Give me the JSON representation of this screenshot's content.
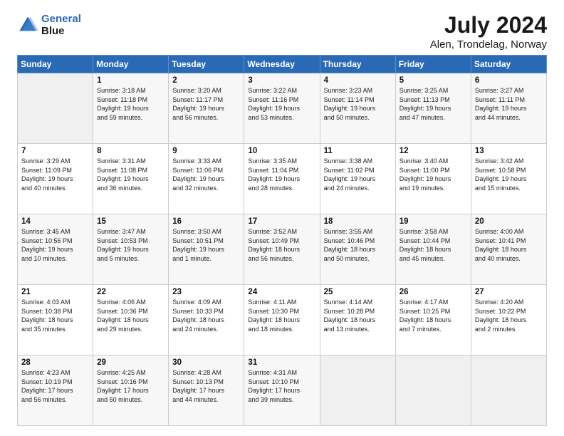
{
  "logo": {
    "line1": "General",
    "line2": "Blue"
  },
  "title": "July 2024",
  "subtitle": "Alen, Trondelag, Norway",
  "header_days": [
    "Sunday",
    "Monday",
    "Tuesday",
    "Wednesday",
    "Thursday",
    "Friday",
    "Saturday"
  ],
  "weeks": [
    [
      {
        "day": "",
        "content": ""
      },
      {
        "day": "1",
        "content": "Sunrise: 3:18 AM\nSunset: 11:18 PM\nDaylight: 19 hours\nand 59 minutes."
      },
      {
        "day": "2",
        "content": "Sunrise: 3:20 AM\nSunset: 11:17 PM\nDaylight: 19 hours\nand 56 minutes."
      },
      {
        "day": "3",
        "content": "Sunrise: 3:22 AM\nSunset: 11:16 PM\nDaylight: 19 hours\nand 53 minutes."
      },
      {
        "day": "4",
        "content": "Sunrise: 3:23 AM\nSunset: 11:14 PM\nDaylight: 19 hours\nand 50 minutes."
      },
      {
        "day": "5",
        "content": "Sunrise: 3:25 AM\nSunset: 11:13 PM\nDaylight: 19 hours\nand 47 minutes."
      },
      {
        "day": "6",
        "content": "Sunrise: 3:27 AM\nSunset: 11:11 PM\nDaylight: 19 hours\nand 44 minutes."
      }
    ],
    [
      {
        "day": "7",
        "content": "Sunrise: 3:29 AM\nSunset: 11:09 PM\nDaylight: 19 hours\nand 40 minutes."
      },
      {
        "day": "8",
        "content": "Sunrise: 3:31 AM\nSunset: 11:08 PM\nDaylight: 19 hours\nand 36 minutes."
      },
      {
        "day": "9",
        "content": "Sunrise: 3:33 AM\nSunset: 11:06 PM\nDaylight: 19 hours\nand 32 minutes."
      },
      {
        "day": "10",
        "content": "Sunrise: 3:35 AM\nSunset: 11:04 PM\nDaylight: 19 hours\nand 28 minutes."
      },
      {
        "day": "11",
        "content": "Sunrise: 3:38 AM\nSunset: 11:02 PM\nDaylight: 19 hours\nand 24 minutes."
      },
      {
        "day": "12",
        "content": "Sunrise: 3:40 AM\nSunset: 11:00 PM\nDaylight: 19 hours\nand 19 minutes."
      },
      {
        "day": "13",
        "content": "Sunrise: 3:42 AM\nSunset: 10:58 PM\nDaylight: 19 hours\nand 15 minutes."
      }
    ],
    [
      {
        "day": "14",
        "content": "Sunrise: 3:45 AM\nSunset: 10:56 PM\nDaylight: 19 hours\nand 10 minutes."
      },
      {
        "day": "15",
        "content": "Sunrise: 3:47 AM\nSunset: 10:53 PM\nDaylight: 19 hours\nand 5 minutes."
      },
      {
        "day": "16",
        "content": "Sunrise: 3:50 AM\nSunset: 10:51 PM\nDaylight: 19 hours\nand 1 minute."
      },
      {
        "day": "17",
        "content": "Sunrise: 3:52 AM\nSunset: 10:49 PM\nDaylight: 18 hours\nand 56 minutes."
      },
      {
        "day": "18",
        "content": "Sunrise: 3:55 AM\nSunset: 10:46 PM\nDaylight: 18 hours\nand 50 minutes."
      },
      {
        "day": "19",
        "content": "Sunrise: 3:58 AM\nSunset: 10:44 PM\nDaylight: 18 hours\nand 45 minutes."
      },
      {
        "day": "20",
        "content": "Sunrise: 4:00 AM\nSunset: 10:41 PM\nDaylight: 18 hours\nand 40 minutes."
      }
    ],
    [
      {
        "day": "21",
        "content": "Sunrise: 4:03 AM\nSunset: 10:38 PM\nDaylight: 18 hours\nand 35 minutes."
      },
      {
        "day": "22",
        "content": "Sunrise: 4:06 AM\nSunset: 10:36 PM\nDaylight: 18 hours\nand 29 minutes."
      },
      {
        "day": "23",
        "content": "Sunrise: 4:09 AM\nSunset: 10:33 PM\nDaylight: 18 hours\nand 24 minutes."
      },
      {
        "day": "24",
        "content": "Sunrise: 4:11 AM\nSunset: 10:30 PM\nDaylight: 18 hours\nand 18 minutes."
      },
      {
        "day": "25",
        "content": "Sunrise: 4:14 AM\nSunset: 10:28 PM\nDaylight: 18 hours\nand 13 minutes."
      },
      {
        "day": "26",
        "content": "Sunrise: 4:17 AM\nSunset: 10:25 PM\nDaylight: 18 hours\nand 7 minutes."
      },
      {
        "day": "27",
        "content": "Sunrise: 4:20 AM\nSunset: 10:22 PM\nDaylight: 18 hours\nand 2 minutes."
      }
    ],
    [
      {
        "day": "28",
        "content": "Sunrise: 4:23 AM\nSunset: 10:19 PM\nDaylight: 17 hours\nand 56 minutes."
      },
      {
        "day": "29",
        "content": "Sunrise: 4:25 AM\nSunset: 10:16 PM\nDaylight: 17 hours\nand 50 minutes."
      },
      {
        "day": "30",
        "content": "Sunrise: 4:28 AM\nSunset: 10:13 PM\nDaylight: 17 hours\nand 44 minutes."
      },
      {
        "day": "31",
        "content": "Sunrise: 4:31 AM\nSunset: 10:10 PM\nDaylight: 17 hours\nand 39 minutes."
      },
      {
        "day": "",
        "content": ""
      },
      {
        "day": "",
        "content": ""
      },
      {
        "day": "",
        "content": ""
      }
    ]
  ]
}
